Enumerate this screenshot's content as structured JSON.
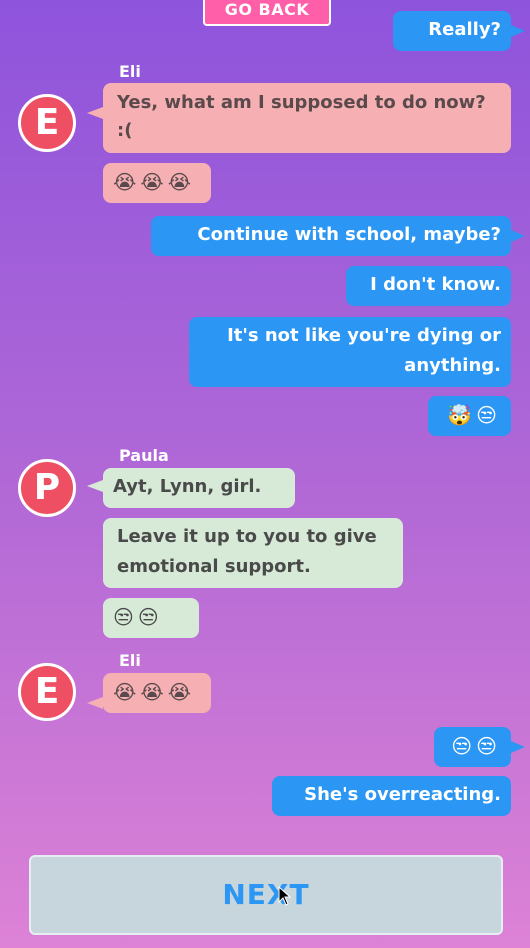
{
  "header": {
    "go_back_label": "GO BACK"
  },
  "messages": [
    {
      "sender": "me",
      "text": "Really?"
    },
    {
      "sender": "Eli",
      "text": "Yes, what am I supposed to do now? :("
    },
    {
      "sender": "Eli",
      "text": "😭😭😭"
    },
    {
      "sender": "me",
      "text": "Continue with school, maybe?"
    },
    {
      "sender": "me",
      "text": "I don't know."
    },
    {
      "sender": "me",
      "text": "It's not like you're dying or anything."
    },
    {
      "sender": "me",
      "text": "🤯😒"
    },
    {
      "sender": "Paula",
      "text": "Ayt, Lynn, girl."
    },
    {
      "sender": "Paula",
      "text": "Leave it up to you to give emotional support."
    },
    {
      "sender": "Paula",
      "text": "😒😒"
    },
    {
      "sender": "Eli",
      "text": "😭😭😭"
    },
    {
      "sender": "me",
      "text": "😒😒"
    },
    {
      "sender": "me",
      "text": "She's overreacting."
    }
  ],
  "avatars": {
    "eli_initial": "E",
    "paula_initial": "P"
  },
  "names": {
    "eli": "Eli",
    "paula": "Paula"
  },
  "footer": {
    "next_label": "NEXT"
  },
  "colors": {
    "outgoing_bubble": "#2b96f3",
    "eli_bubble": "#f6b0b3",
    "paula_bubble": "#d6ead7",
    "avatar": "#ee4f63",
    "go_back": "#ff5fa8"
  }
}
